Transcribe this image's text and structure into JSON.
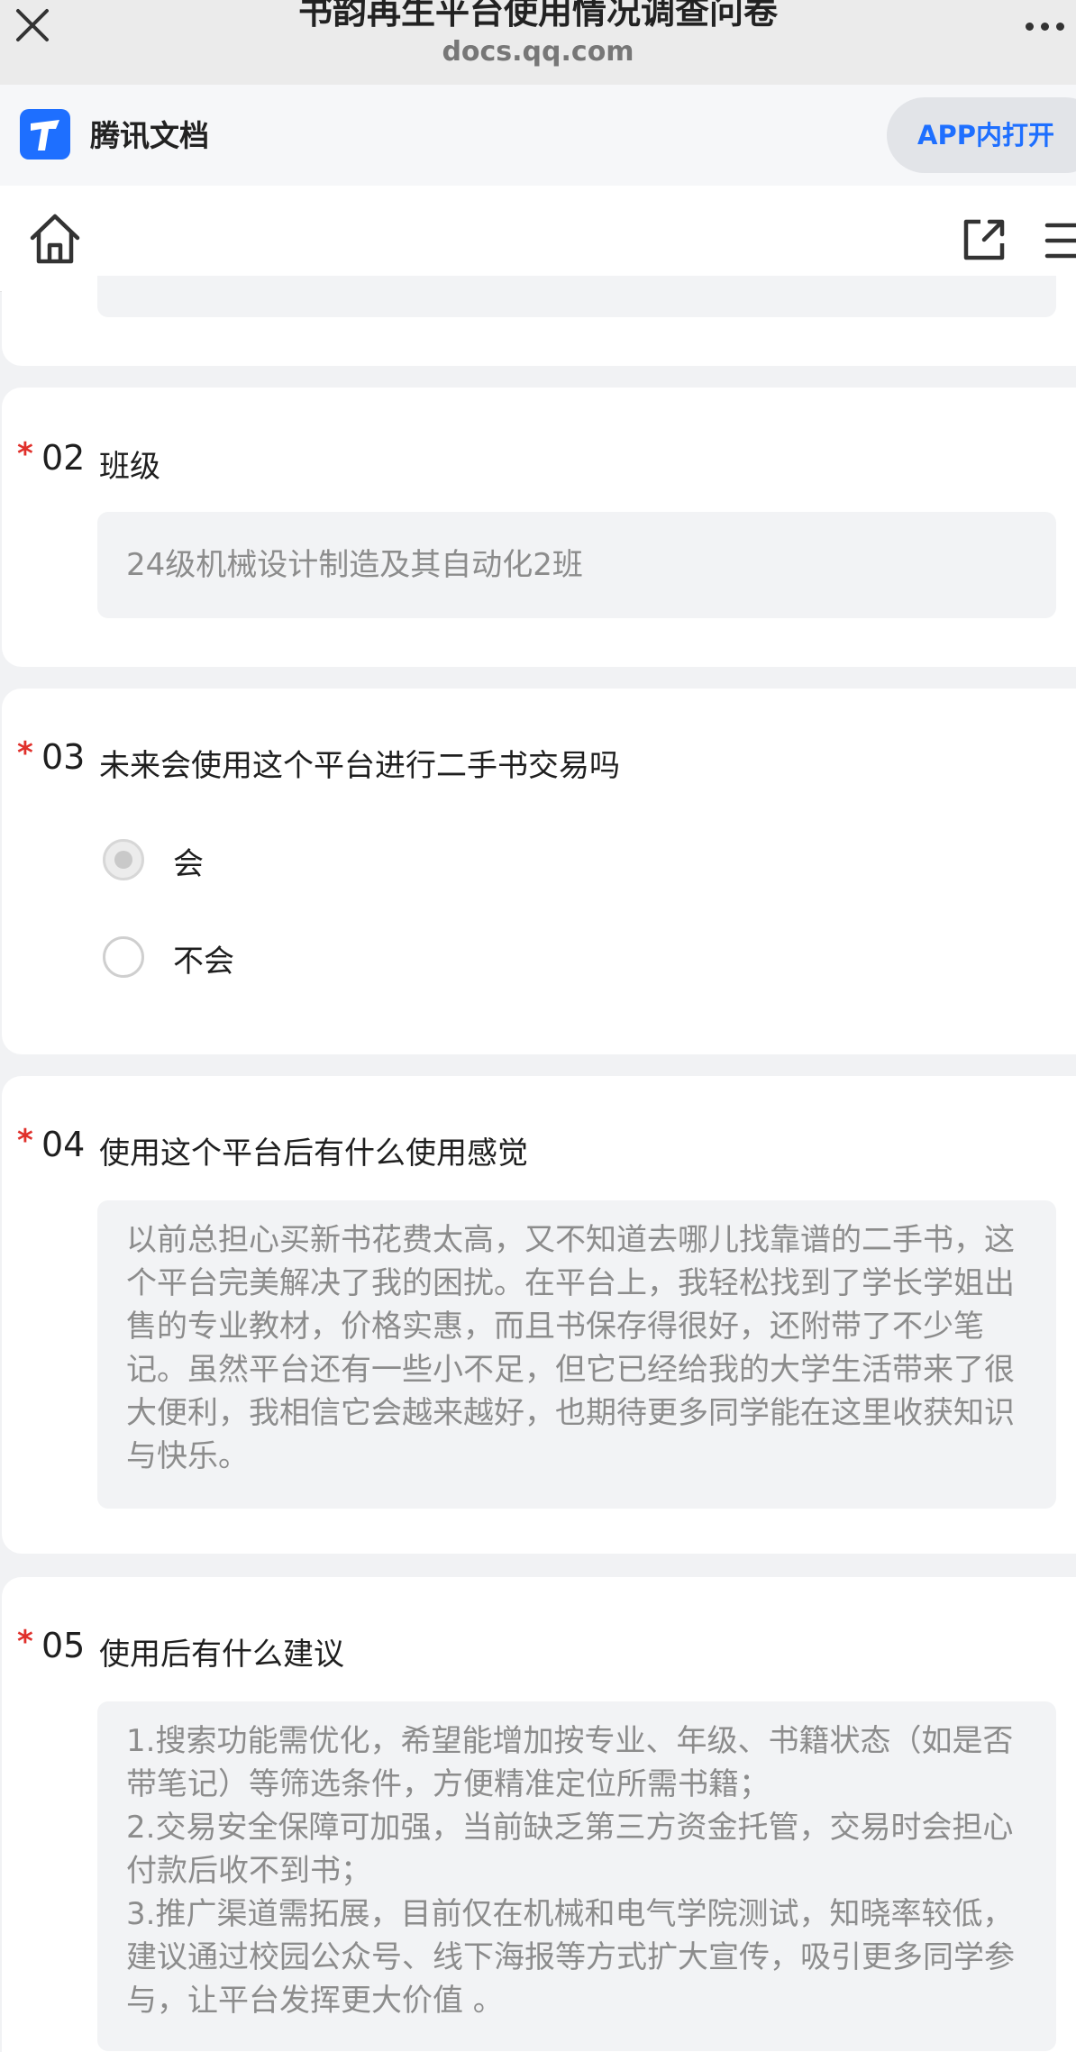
{
  "browser": {
    "title": "书韵再生平台使用情况调查问卷",
    "url": "docs.qq.com"
  },
  "app_banner": {
    "app_name": "腾讯文档",
    "open_button": "APP内打开",
    "brand_color": "#1e6fff"
  },
  "questions": [
    {
      "number": "02",
      "title": "班级",
      "required_mark": "*",
      "answer": "24级机械设计制造及其自动化2班"
    },
    {
      "number": "03",
      "title": "未来会使用这个平台进行二手书交易吗",
      "required_mark": "*",
      "options": [
        {
          "label": "会",
          "selected": true
        },
        {
          "label": "不会",
          "selected": false
        }
      ]
    },
    {
      "number": "04",
      "title": "使用这个平台后有什么使用感觉",
      "required_mark": "*",
      "answer": "以前总担心买新书花费太高，又不知道去哪儿找靠谱的二手书，这个平台完美解决了我的困扰。在平台上，我轻松找到了学长学姐出售的专业教材，价格实惠，而且书保存得很好，还附带了不少笔记。虽然平台还有一些小不足，但它已经给我的大学生活带来了很大便利，我相信它会越来越好，也期待更多同学能在这里收获知识与快乐。"
    },
    {
      "number": "05",
      "title": "使用后有什么建议",
      "required_mark": "*",
      "answer_lines": [
        "1.搜索功能需优化，希望能增加按专业、年级、书籍状态（如是否带笔记）等筛选条件，方便精准定位所需书籍；",
        "2.交易安全保障可加强，当前缺乏第三方资金托管，交易时会担心付款后收不到书；",
        "3.推广渠道需拓展，目前仅在机械和电气学院测试，知晓率较低，建议通过校园公众号、线下海报等方式扩大宣传，吸引更多同学参与，让平台发挥更大价值 。"
      ]
    }
  ],
  "colors": {
    "required_star": "#e0302b",
    "answer_bg": "#f2f3f5",
    "answer_text": "#8c8c8c"
  }
}
